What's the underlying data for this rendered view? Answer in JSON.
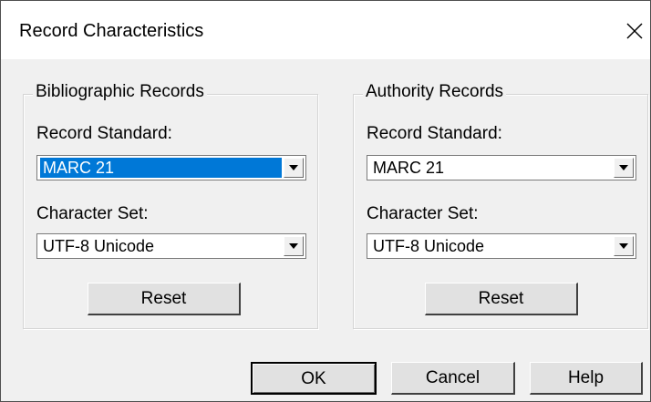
{
  "window": {
    "title": "Record Characteristics",
    "close_icon": "close-icon"
  },
  "bibliographic": {
    "legend": "Bibliographic Records",
    "record_standard_label": "Record Standard:",
    "record_standard_value": "MARC 21",
    "character_set_label": "Character Set:",
    "character_set_value": "UTF-8 Unicode",
    "reset_label": "Reset"
  },
  "authority": {
    "legend": "Authority Records",
    "record_standard_label": "Record Standard:",
    "record_standard_value": "MARC 21",
    "character_set_label": "Character Set:",
    "character_set_value": "UTF-8 Unicode",
    "reset_label": "Reset"
  },
  "buttons": {
    "ok": "OK",
    "cancel": "Cancel",
    "help": "Help"
  },
  "colors": {
    "selection": "#0078d7",
    "title_bar": "#ffffff",
    "dialog_bg": "#f0f0f0"
  }
}
